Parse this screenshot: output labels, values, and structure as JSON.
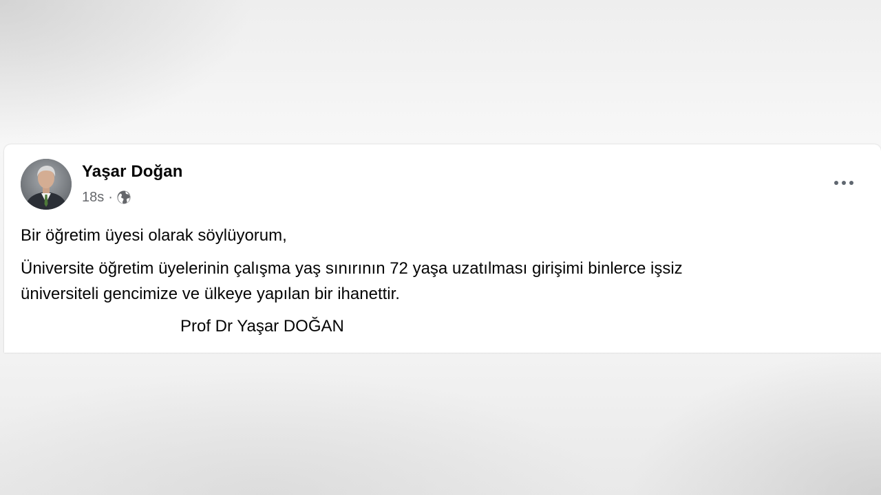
{
  "post": {
    "author": "Yaşar Doğan",
    "timestamp": "18s",
    "separator": "·",
    "audience_icon": "globe-icon",
    "more_icon": "more-options-icon",
    "paragraphs": [
      "Bir öğretim üyesi olarak söylüyorum,",
      "Üniversite öğretim üyelerinin çalışma yaş sınırının 72 yaşa uzatılması girişimi binlerce işsiz",
      "üniversiteli gencimize ve ülkeye yapılan bir ihanettir."
    ],
    "signature": "Prof Dr Yaşar DOĞAN"
  },
  "colors": {
    "card_background": "#ffffff",
    "primary_text": "#050505",
    "secondary_text": "#65676b"
  }
}
